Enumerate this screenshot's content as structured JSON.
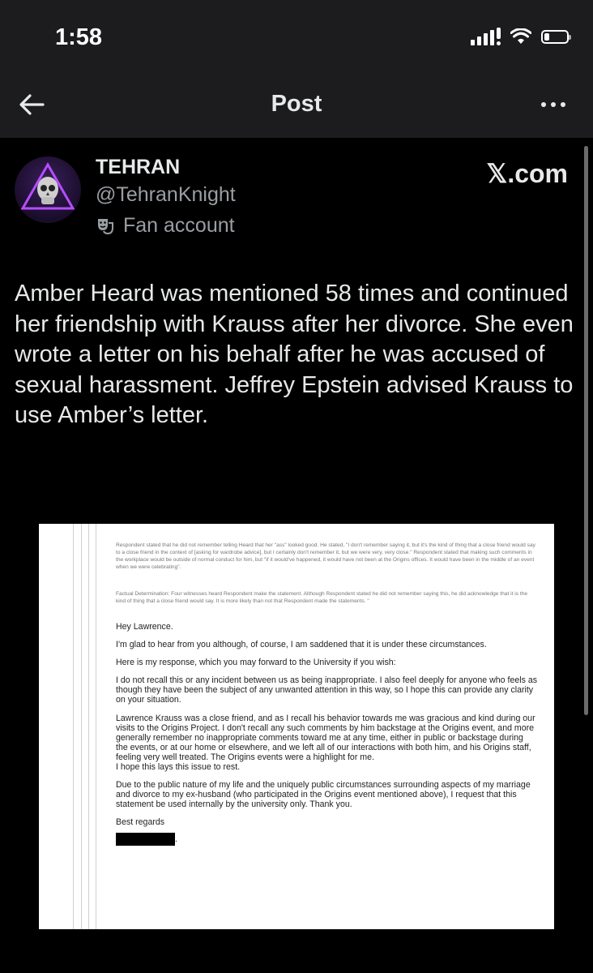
{
  "status_bar": {
    "time": "1:58"
  },
  "nav": {
    "title": "Post"
  },
  "author": {
    "name": "TEHRAN",
    "handle": "@TehranKnight",
    "label": "Fan account",
    "source": "𝕏.com"
  },
  "tweet": {
    "text": "Amber Heard was mentioned 58 times and continued her friendship with Krauss after her divorce. She even wrote a letter on his behalf after he was accused of sexual harassment. Jeffrey Epstein advised Krauss to use Amber’s letter."
  },
  "document": {
    "header_note": "Respondent stated that he did not remember telling Heard that her \"ass\" looked good. He stated, \"I don't remember saying it, but it's the kind of thing that a close friend would say to a close friend in the context of [asking for wardrobe advice], but I certainly don't remember it, but we were very, very close.\" Respondent stated that making such comments in the workplace would be outside of normal conduct for him, but \"if it would've happened, it would have not been at the Origins offices. It would have been in the middle of an event when we were celebrating\".",
    "factual_note": "Factual Determination: Four witnesses heard Respondent make the statement. Although Respondent stated he did not remember saying this, he did acknowledge that it is the kind of thing that a close friend would say. It is more likely than not that Respondent made the statements. \"",
    "greeting": "Hey Lawrence.",
    "p1": "I'm glad to hear from you although, of course, I am saddened that it is under these circumstances.",
    "p2": "Here is my response, which you may forward to the University if you wish:",
    "p3": "I do not recall this or any incident between us as being inappropriate. I also feel deeply for anyone who feels as though they have been the subject of any unwanted attention in this way, so I hope this can provide any clarity on your situation.",
    "p4": "Lawrence Krauss was a close friend, and as I recall his behavior towards me was gracious and kind during our visits to the Origins Project.  I don't recall any such comments by him backstage at the Origins event, and more generally remember no inappropriate comments toward me at any time, either in public or backstage during the events, or at our home or elsewhere, and we left all of our interactions with both him, and his Origins staff, feeling very well treated. The Origins events were a highlight for me.",
    "p4b": "I hope this lays this issue to rest.",
    "p5": "Due to the public nature of my life and the uniquely public circumstances surrounding aspects of my marriage and divorce to my ex-husband (who participated in the Origins event mentioned above), I request that this statement be used internally by the university only. Thank you.",
    "closing": "Best regards",
    "signature_suffix": "."
  }
}
